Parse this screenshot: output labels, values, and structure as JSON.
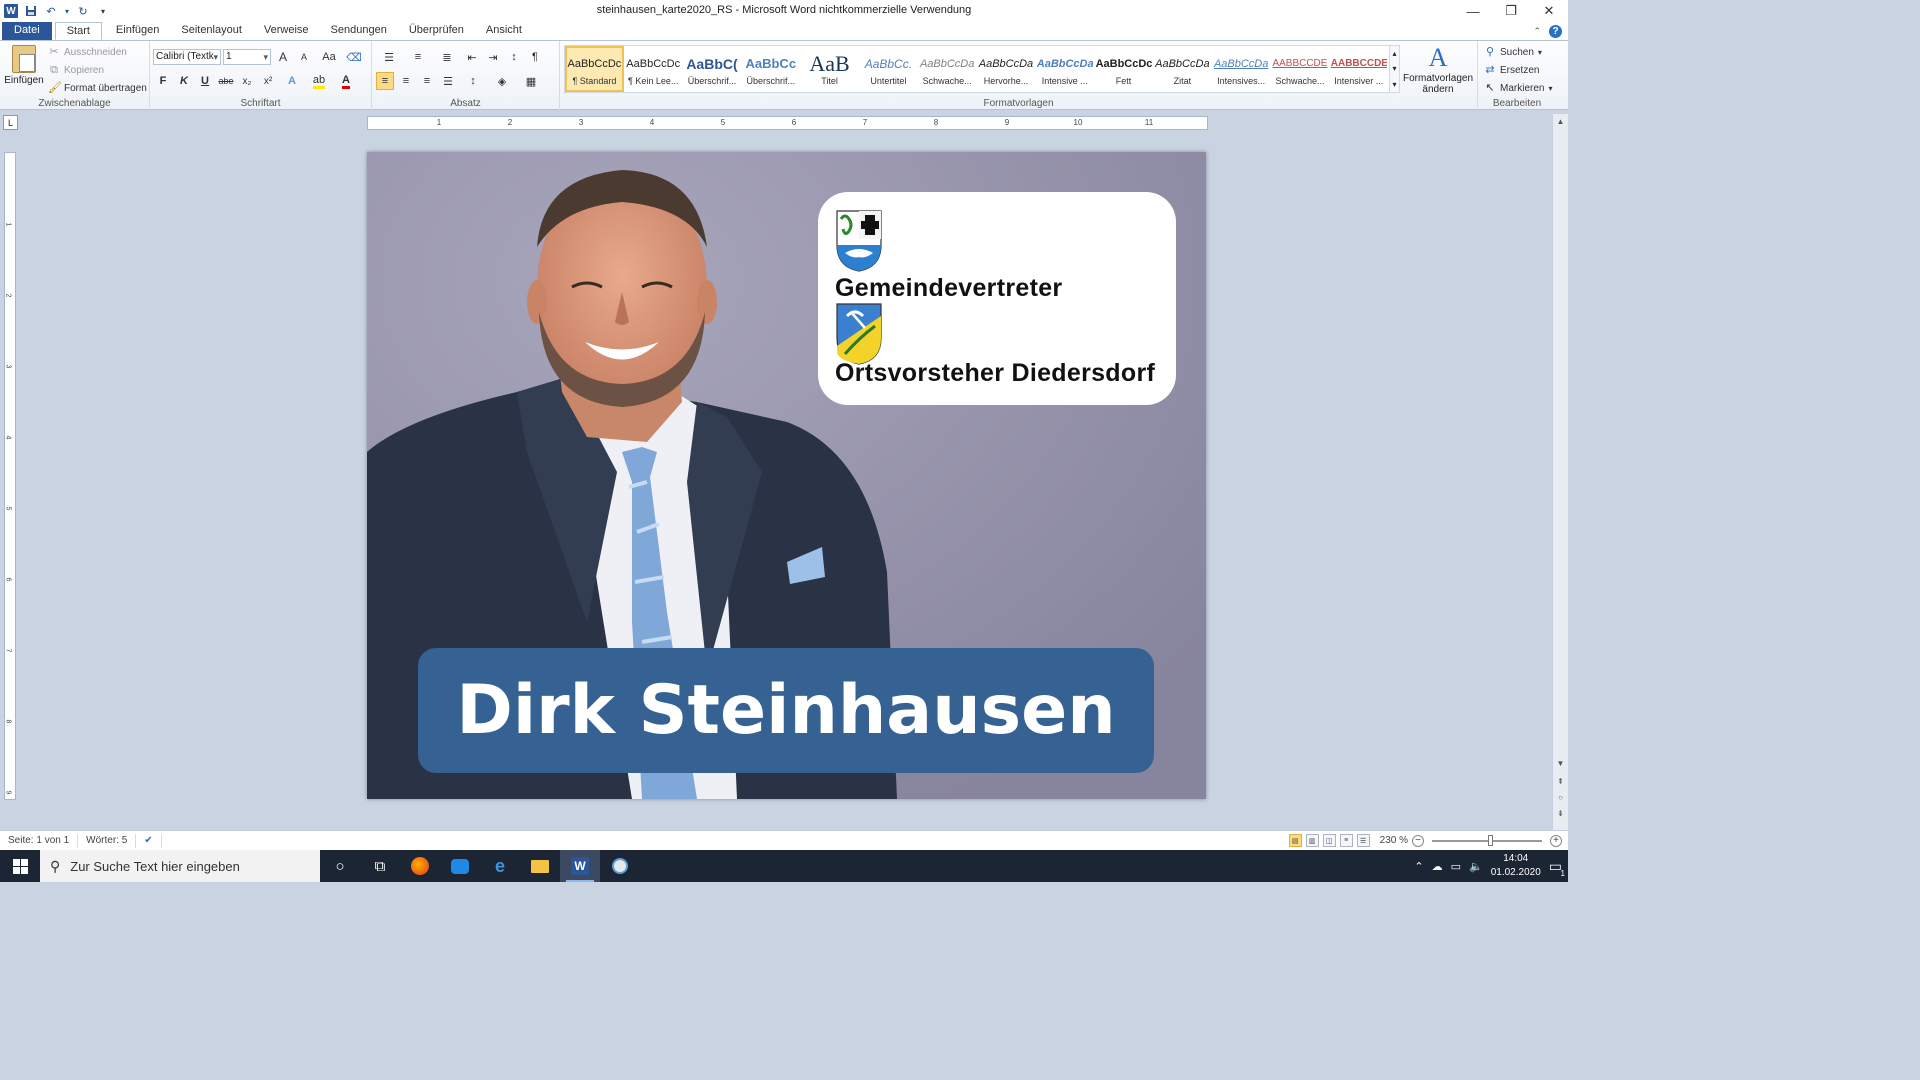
{
  "window": {
    "title": "steinhausen_karte2020_RS - Microsoft Word nichtkommerzielle Verwendung",
    "minimize": "—",
    "restore": "❐",
    "close": "✕"
  },
  "quick_access": {
    "app_icon": "W",
    "save_icon": "floppy-icon",
    "undo_icon": "undo-icon",
    "redo_icon": "redo-icon",
    "customize_icon": "dropdown-icon"
  },
  "tabs": [
    "Datei",
    "Start",
    "Einfügen",
    "Seitenlayout",
    "Verweise",
    "Sendungen",
    "Überprüfen",
    "Ansicht"
  ],
  "ribbon": {
    "clipboard": {
      "label": "Zwischenablage",
      "paste": "Einfügen",
      "cut": "Ausschneiden",
      "copy": "Kopieren",
      "format_painter": "Format übertragen"
    },
    "font": {
      "label": "Schriftart",
      "font_name": "Calibri (Textk",
      "font_size": "1",
      "bold": "F",
      "italic": "K",
      "underline": "U",
      "strikethrough": "abe",
      "subscript": "x₂",
      "superscript": "x²",
      "grow": "A",
      "shrink": "A",
      "case": "Aa"
    },
    "paragraph": {
      "label": "Absatz"
    },
    "styles": {
      "label": "Formatvorlagen",
      "items": [
        {
          "preview": "AaBbCcDc",
          "name": "¶ Standard"
        },
        {
          "preview": "AaBbCcDc",
          "name": "¶ Kein Lee..."
        },
        {
          "preview": "AaBbC(",
          "name": "Überschrif..."
        },
        {
          "preview": "AaBbCc",
          "name": "Überschrif..."
        },
        {
          "preview": "AaB",
          "name": "Titel"
        },
        {
          "preview": "AaBbCc.",
          "name": "Untertitel"
        },
        {
          "preview": "AaBbCcDa",
          "name": "Schwache..."
        },
        {
          "preview": "AaBbCcDa",
          "name": "Hervorhe..."
        },
        {
          "preview": "AaBbCcDa",
          "name": "Intensive ..."
        },
        {
          "preview": "AaBbCcDc",
          "name": "Fett"
        },
        {
          "preview": "AaBbCcDa",
          "name": "Zitat"
        },
        {
          "preview": "AaBbCcDa",
          "name": "Intensives..."
        },
        {
          "preview": "AABBCCDE",
          "name": "Schwache..."
        },
        {
          "preview": "AABBCCDE",
          "name": "Intensiver ..."
        }
      ],
      "change_styles": "Formatvorlagen ändern"
    },
    "editing": {
      "label": "Bearbeiten",
      "find": "Suchen",
      "replace": "Ersetzen",
      "select": "Markieren"
    }
  },
  "ruler": {
    "numbers": [
      "1",
      "2",
      "3",
      "4",
      "5",
      "6",
      "7",
      "8",
      "9",
      "10",
      "11"
    ],
    "vnumbers": [
      "1",
      "2",
      "3",
      "4",
      "5",
      "6",
      "7",
      "8",
      "9"
    ]
  },
  "document": {
    "card": {
      "line1": "Gemeindevertreter",
      "line2": "Ortsvorsteher Diedersdorf"
    },
    "name": "Dirk Steinhausen",
    "colors": {
      "banner": "#366293",
      "background": "#8d8aa4",
      "card": "#ffffff"
    }
  },
  "status": {
    "page": "Seite: 1 von 1",
    "words": "Wörter: 5",
    "zoom": "230 %"
  },
  "taskbar": {
    "search_placeholder": "Zur Suche Text hier eingeben",
    "time": "14:04",
    "date": "01.02.2020",
    "notification_count": "1"
  }
}
